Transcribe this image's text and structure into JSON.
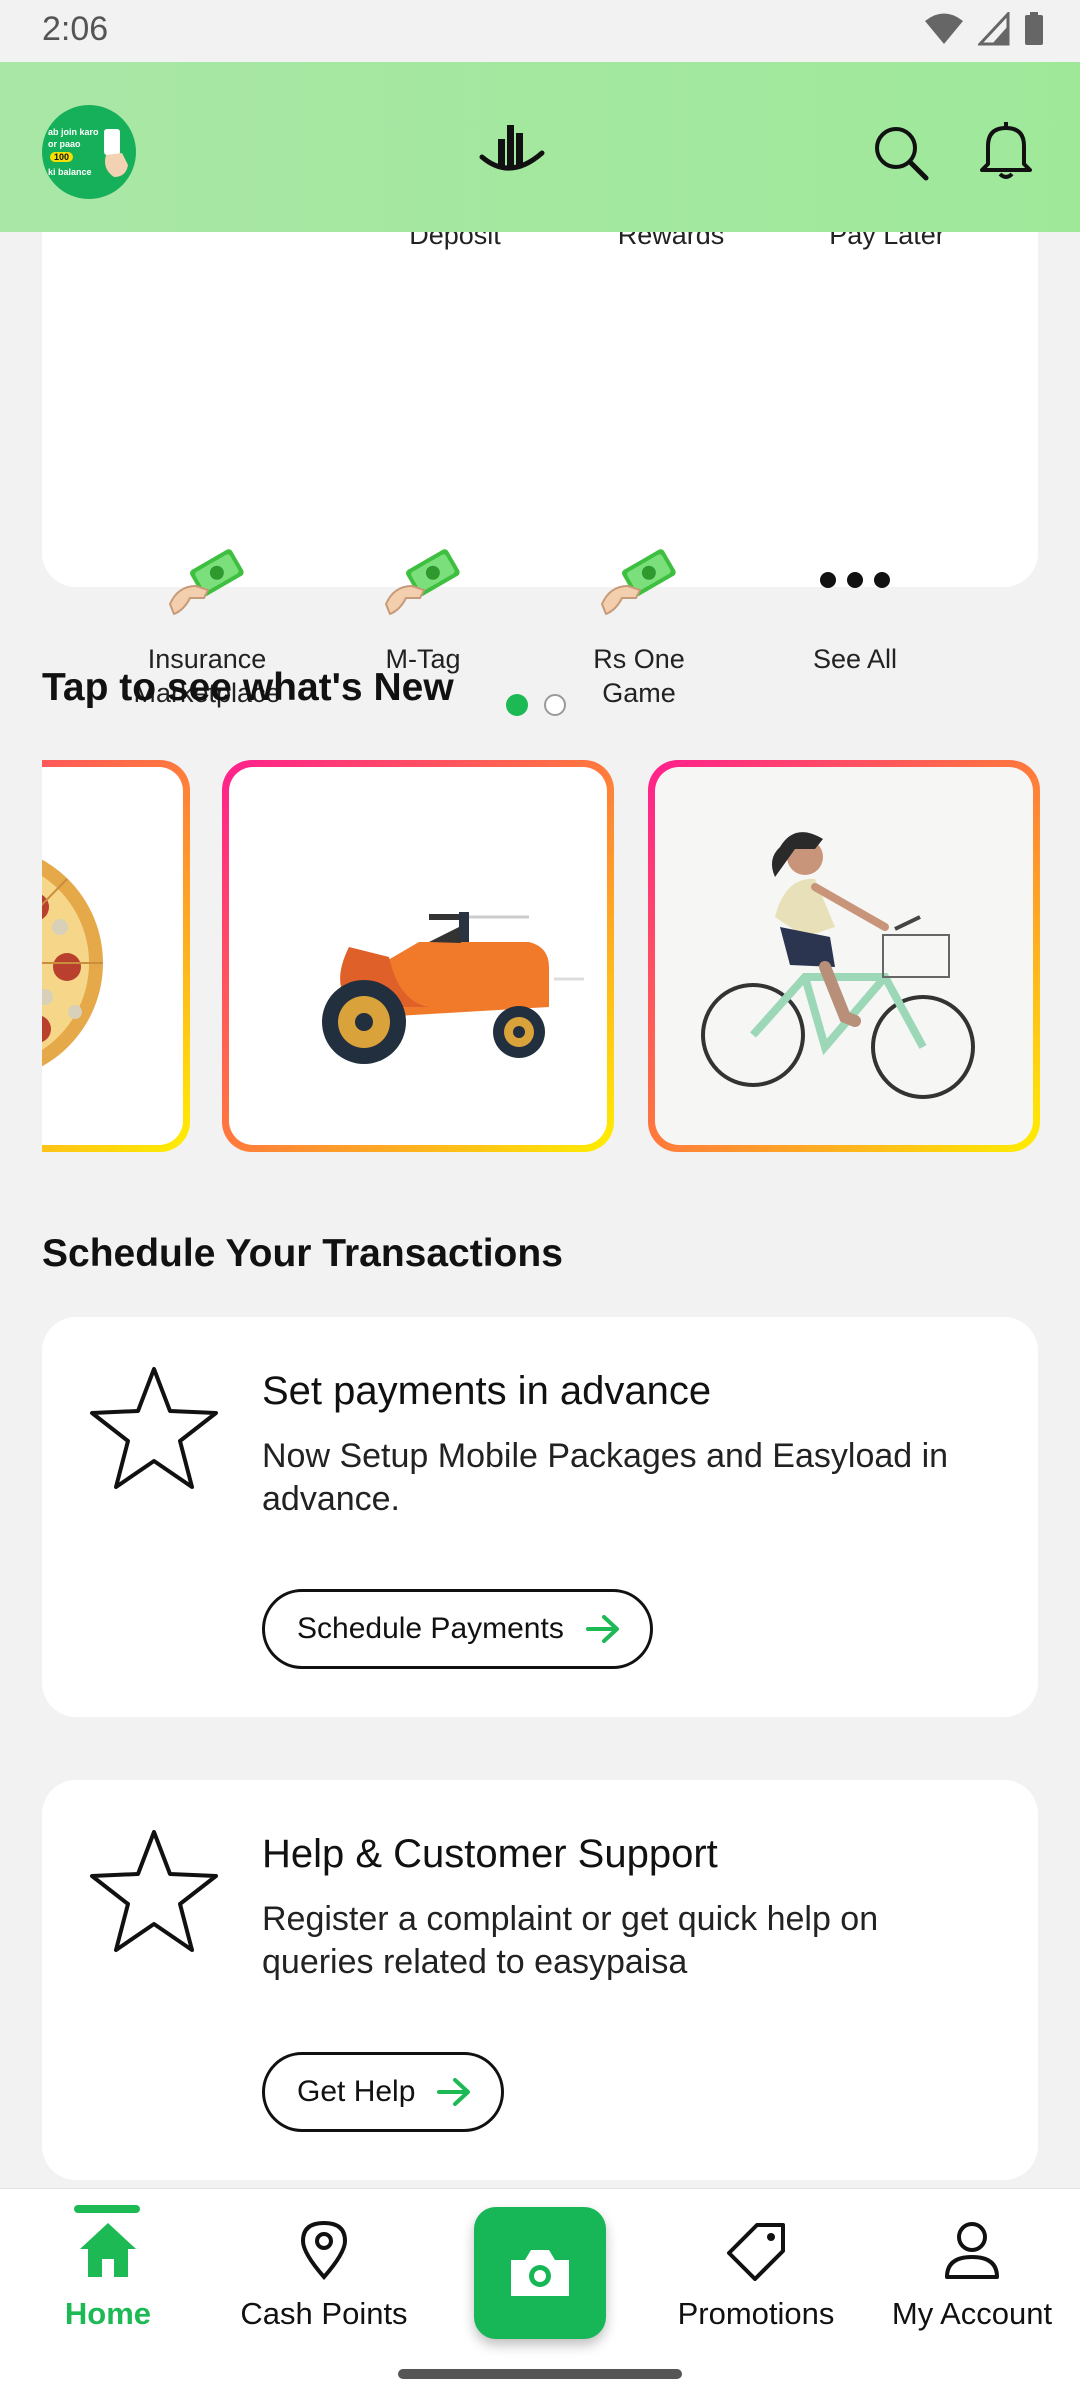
{
  "status": {
    "time": "2:06"
  },
  "header": {
    "promo_lines": [
      "ab join karo",
      "or paao",
      "100",
      "ki balance"
    ]
  },
  "services": {
    "cut_row": [
      "Deposit",
      "Rewards",
      "Pay Later"
    ],
    "items": [
      {
        "label": "Insurance Marketplace",
        "icon": "cash-hand-icon"
      },
      {
        "label": "M-Tag",
        "icon": "cash-hand-icon"
      },
      {
        "label": "Rs One Game",
        "icon": "cash-hand-icon"
      },
      {
        "label": "See All",
        "icon": "more-dots-icon"
      }
    ],
    "page_indicator": {
      "current": 1,
      "total": 2
    }
  },
  "whats_new": {
    "title": "Tap to see what's New",
    "stories": [
      "pizza",
      "tractor",
      "bicycle-rider"
    ]
  },
  "schedule": {
    "section_title": "Schedule Your Transactions",
    "cards": [
      {
        "title": "Set payments in advance",
        "description": "Now Setup Mobile Packages and Easyload in advance.",
        "button": "Schedule Payments"
      },
      {
        "title": "Help & Customer Support",
        "description": "Register a complaint or get quick help on queries related to easypaisa",
        "button": "Get Help"
      }
    ]
  },
  "bottom_nav": {
    "items": [
      {
        "label": "Home",
        "icon": "home-icon",
        "active": true
      },
      {
        "label": "Cash Points",
        "icon": "location-pin-icon",
        "active": false
      },
      {
        "label": "",
        "icon": "camera-icon",
        "active": false
      },
      {
        "label": "Promotions",
        "icon": "tag-icon",
        "active": false
      },
      {
        "label": "My Account",
        "icon": "user-icon",
        "active": false
      }
    ]
  },
  "colors": {
    "brand_green": "#1db955",
    "header_green": "#a9e7a6",
    "background": "#f2f2f2"
  }
}
